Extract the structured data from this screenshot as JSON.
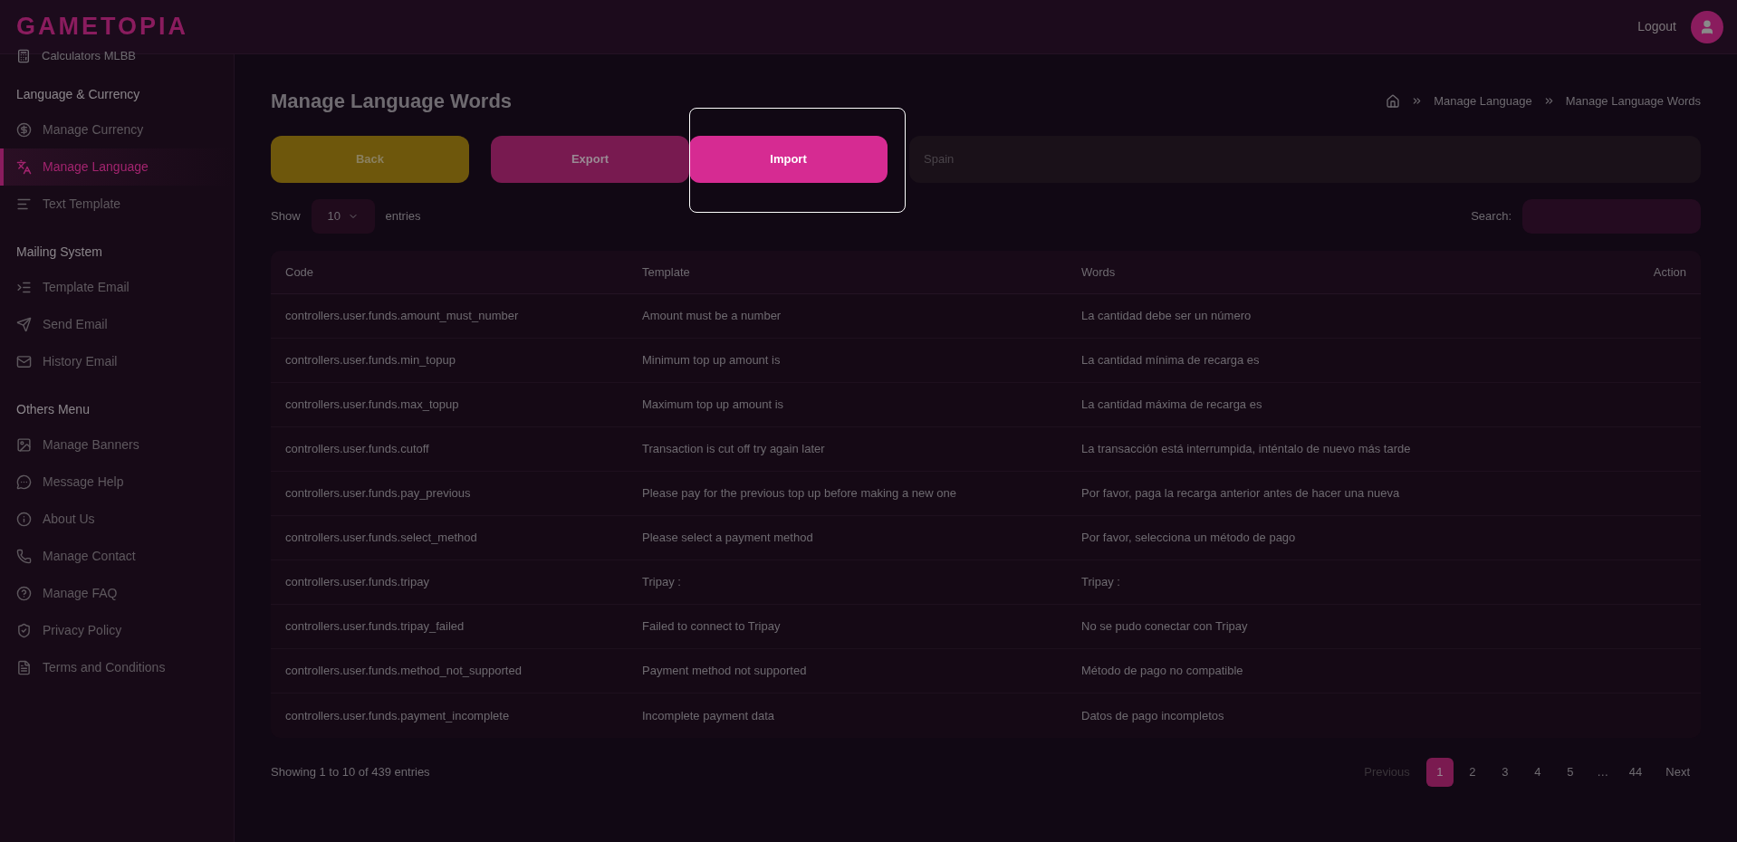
{
  "brand": "GAMETOPIA",
  "header": {
    "logout": "Logout"
  },
  "sidebar": {
    "top_item": "Calculators MLBB",
    "sections": [
      {
        "title": "Language & Currency",
        "items": [
          {
            "label": "Manage Currency",
            "selected": false
          },
          {
            "label": "Manage Language",
            "selected": true
          },
          {
            "label": "Text Template",
            "selected": false
          }
        ]
      },
      {
        "title": "Mailing System",
        "items": [
          {
            "label": "Template Email",
            "selected": false
          },
          {
            "label": "Send Email",
            "selected": false
          },
          {
            "label": "History Email",
            "selected": false
          }
        ]
      },
      {
        "title": "Others Menu",
        "items": [
          {
            "label": "Manage Banners",
            "selected": false
          },
          {
            "label": "Message Help",
            "selected": false
          },
          {
            "label": "About Us",
            "selected": false
          },
          {
            "label": "Manage Contact",
            "selected": false
          },
          {
            "label": "Manage FAQ",
            "selected": false
          },
          {
            "label": "Privacy Policy",
            "selected": false
          },
          {
            "label": "Terms and Conditions",
            "selected": false
          }
        ]
      }
    ]
  },
  "page_title": "Manage Language Words",
  "breadcrumb": [
    "Manage Language",
    "Manage Language Words"
  ],
  "actions": [
    {
      "kind": "back",
      "label": "Back",
      "spotlight": false
    },
    {
      "kind": "export",
      "label": "Export",
      "spotlight": false
    },
    {
      "kind": "import",
      "label": "Import",
      "spotlight": true
    }
  ],
  "language_field": {
    "value": "Spain"
  },
  "show": {
    "label": "Show",
    "value": "10",
    "suffix": "entries"
  },
  "search": {
    "label": "Search:"
  },
  "table": {
    "columns": [
      "Code",
      "Template",
      "Words",
      "Action"
    ],
    "rows": [
      [
        "controllers.user.funds.amount_must_number",
        "Amount must be a number",
        "La cantidad debe ser un número"
      ],
      [
        "controllers.user.funds.min_topup",
        "Minimum top up amount is",
        "La cantidad mínima de recarga es"
      ],
      [
        "controllers.user.funds.max_topup",
        "Maximum top up amount is",
        "La cantidad máxima de recarga es"
      ],
      [
        "controllers.user.funds.cutoff",
        "Transaction is cut off try again later",
        "La transacción está interrumpida, inténtalo de nuevo más tarde"
      ],
      [
        "controllers.user.funds.pay_previous",
        "Please pay for the previous top up before making a new one",
        "Por favor, paga la recarga anterior antes de hacer una nueva"
      ],
      [
        "controllers.user.funds.select_method",
        "Please select a payment method",
        "Por favor, selecciona un método de pago"
      ],
      [
        "controllers.user.funds.tripay",
        "Tripay :",
        "Tripay :"
      ],
      [
        "controllers.user.funds.tripay_failed",
        "Failed to connect to Tripay",
        "No se pudo conectar con Tripay"
      ],
      [
        "controllers.user.funds.method_not_supported",
        "Payment method not supported",
        "Método de pago no compatible"
      ],
      [
        "controllers.user.funds.payment_incomplete",
        "Incomplete payment data",
        "Datos de pago incompletos"
      ]
    ]
  },
  "footer": {
    "info": "Showing 1 to 10 of 439 entries"
  },
  "pagination": {
    "previous": {
      "label": "Previous",
      "disabled": true
    },
    "pages": [
      {
        "label": "1",
        "selected": true
      },
      {
        "label": "2",
        "selected": false
      },
      {
        "label": "3",
        "selected": false
      },
      {
        "label": "4",
        "selected": false
      },
      {
        "label": "5",
        "selected": false
      },
      {
        "label": "…",
        "selected": false
      },
      {
        "label": "44",
        "selected": false
      }
    ],
    "next": {
      "label": "Next",
      "disabled": false
    }
  }
}
